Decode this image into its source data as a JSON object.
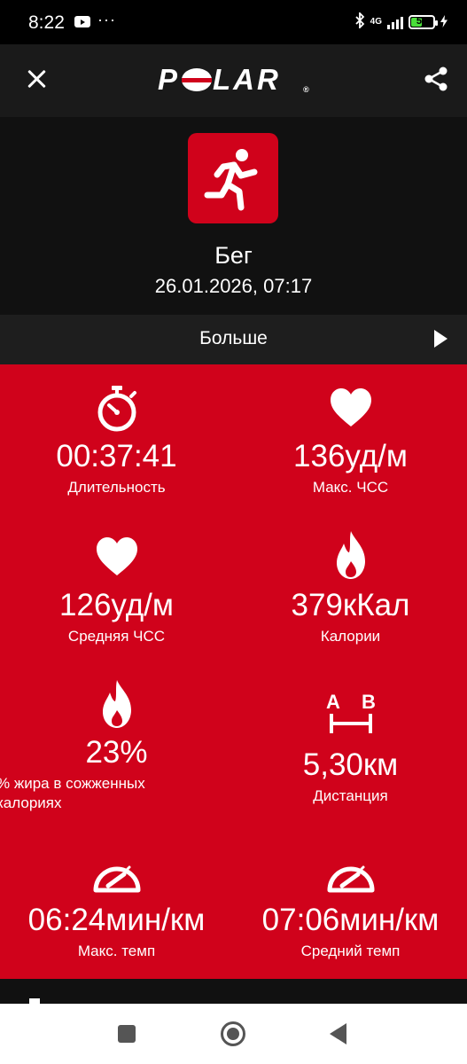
{
  "status_bar": {
    "time": "8:22",
    "dots": "···",
    "network": "4G",
    "battery": "50"
  },
  "header": {
    "logo_text": "POLAR",
    "logo_mark": "®"
  },
  "session": {
    "sport": "Бег",
    "datetime": "26.01.2026, 07:17"
  },
  "more": {
    "label": "Больше"
  },
  "stats": [
    {
      "icon": "stopwatch-icon",
      "value": "00:37:41",
      "label": "Длительность"
    },
    {
      "icon": "heart-icon",
      "value": "136уд/м",
      "label": "Макс. ЧСС"
    },
    {
      "icon": "heart-icon",
      "value": "126уд/м",
      "label": "Средняя ЧСС"
    },
    {
      "icon": "flame-icon",
      "value": "379кКал",
      "label": "Калории"
    },
    {
      "icon": "flame-icon",
      "value": "23%",
      "label_line1": "% жира в сожженных",
      "label_line2": "калориях"
    },
    {
      "icon": "distance-ab-icon",
      "value": "5,30км",
      "label": "Дистанция",
      "icon_a": "A",
      "icon_b": "B"
    },
    {
      "icon": "speedometer-icon",
      "value": "06:24мин/км",
      "label": "Макс. темп"
    },
    {
      "icon": "speedometer-icon",
      "value": "07:06мин/км",
      "label": "Средний темп"
    }
  ],
  "colors": {
    "brand_red": "#d0021b",
    "background": "#111111",
    "header_bg": "#1a1a1a",
    "battery_green": "#4ade3a"
  }
}
